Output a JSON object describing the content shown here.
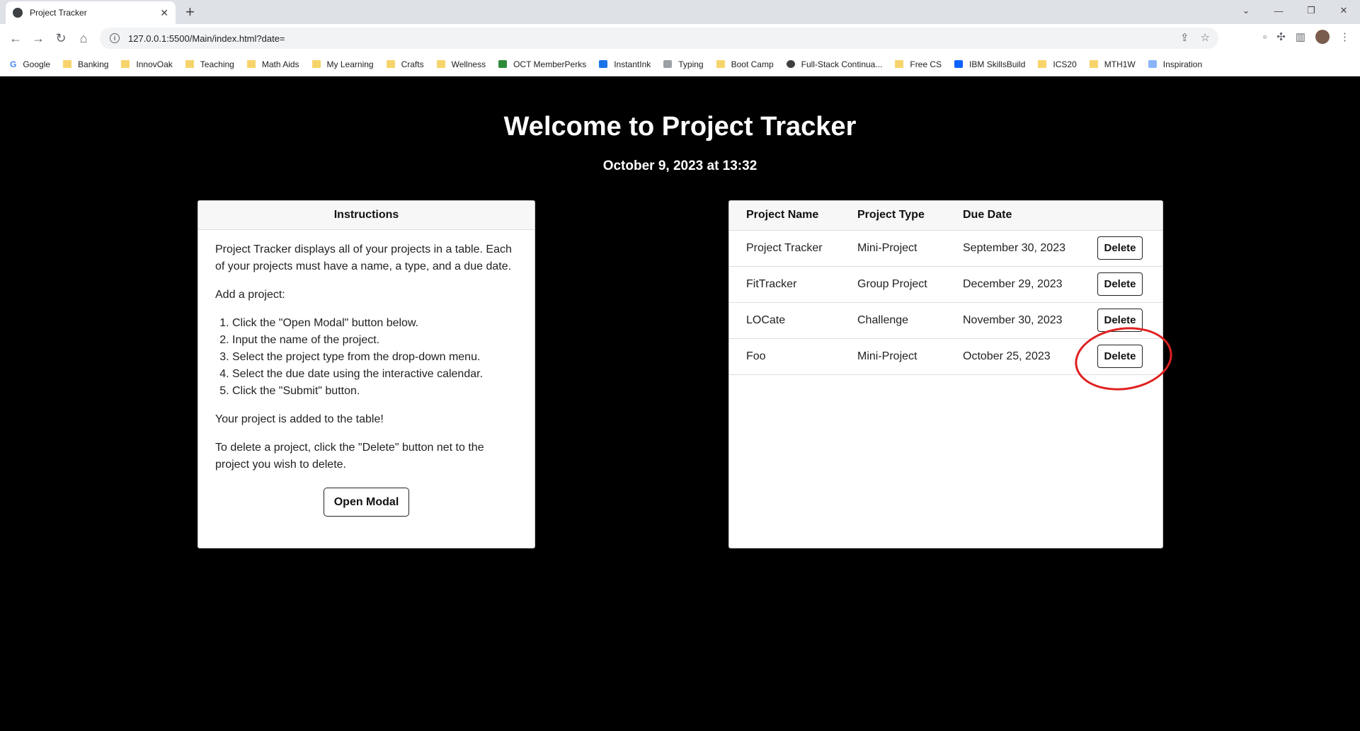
{
  "browser": {
    "tab_title": "Project Tracker",
    "url": "127.0.0.1:5500/Main/index.html?date=",
    "bookmarks": [
      {
        "label": "Google",
        "icon": "google-icon"
      },
      {
        "label": "Banking",
        "icon": "folder-icon"
      },
      {
        "label": "InnovOak",
        "icon": "folder-icon"
      },
      {
        "label": "Teaching",
        "icon": "folder-icon"
      },
      {
        "label": "Math Aids",
        "icon": "folder-icon"
      },
      {
        "label": "My Learning",
        "icon": "folder-icon"
      },
      {
        "label": "Crafts",
        "icon": "folder-icon"
      },
      {
        "label": "Wellness",
        "icon": "folder-icon"
      },
      {
        "label": "OCT MemberPerks",
        "icon": "oct-icon"
      },
      {
        "label": "InstantInk",
        "icon": "hp-icon"
      },
      {
        "label": "Typing",
        "icon": "typing-icon"
      },
      {
        "label": "Boot Camp",
        "icon": "folder-icon"
      },
      {
        "label": "Full-Stack Continua...",
        "icon": "globe-icon"
      },
      {
        "label": "Free CS",
        "icon": "folder-icon"
      },
      {
        "label": "IBM SkillsBuild",
        "icon": "ibm-icon"
      },
      {
        "label": "ICS20",
        "icon": "folder-icon"
      },
      {
        "label": "MTH1W",
        "icon": "folder-icon"
      },
      {
        "label": "Inspiration",
        "icon": "inspiration-icon"
      }
    ]
  },
  "page": {
    "title": "Welcome to Project Tracker",
    "date": "October 9, 2023 at 13:32"
  },
  "instructions": {
    "header": "Instructions",
    "intro": "Project Tracker displays all of your projects in a table. Each of your projects must have a name, a type, and a due date.",
    "add_heading": "Add a project:",
    "steps": [
      "Click the \"Open Modal\" button below.",
      "Input the name of the project.",
      "Select the project type from the drop-down menu.",
      "Select the due date using the interactive calendar.",
      "Click the \"Submit\" button."
    ],
    "added": "Your project is added to the table!",
    "delete_note": "To delete a project, click the \"Delete\" button net to the project you wish to delete.",
    "button_label": "Open Modal"
  },
  "projects_table": {
    "headers": [
      "Project Name",
      "Project Type",
      "Due Date"
    ],
    "rows": [
      {
        "name": "Project Tracker",
        "type": "Mini-Project",
        "due": "September 30, 2023",
        "action": "Delete"
      },
      {
        "name": "FitTracker",
        "type": "Group Project",
        "due": "December 29, 2023",
        "action": "Delete"
      },
      {
        "name": "LOCate",
        "type": "Challenge",
        "due": "November 30, 2023",
        "action": "Delete"
      },
      {
        "name": "Foo",
        "type": "Mini-Project",
        "due": "October 25, 2023",
        "action": "Delete"
      }
    ]
  },
  "colors": {
    "annotation": "#e02020",
    "page_background": "#000000"
  }
}
